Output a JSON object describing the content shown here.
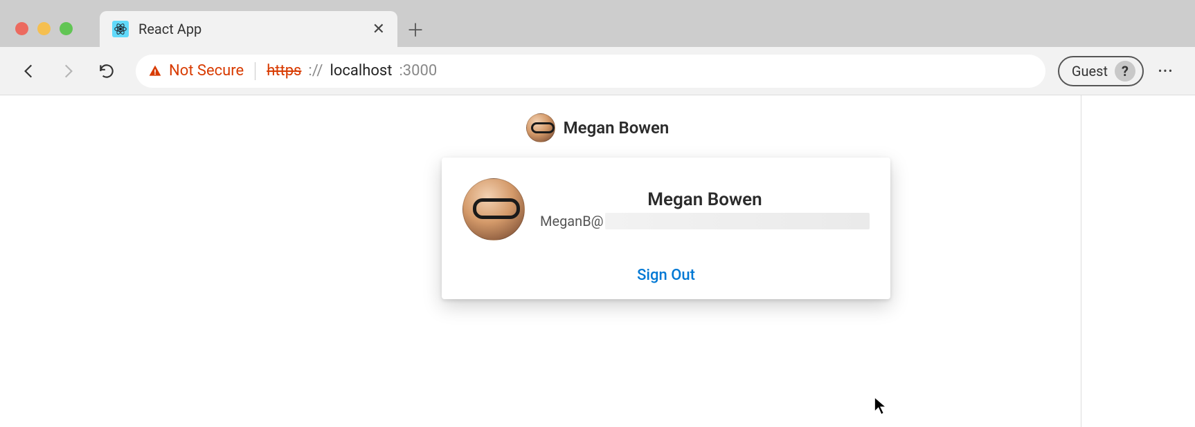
{
  "browser": {
    "tab_title": "React App",
    "security_label": "Not Secure",
    "url_scheme": "https",
    "url_sep": "://",
    "url_host": "localhost",
    "url_port": ":3000",
    "guest_label": "Guest"
  },
  "user": {
    "display_name": "Megan Bowen",
    "email_prefix": "MeganB@"
  },
  "flyout": {
    "signout_label": "Sign Out"
  }
}
